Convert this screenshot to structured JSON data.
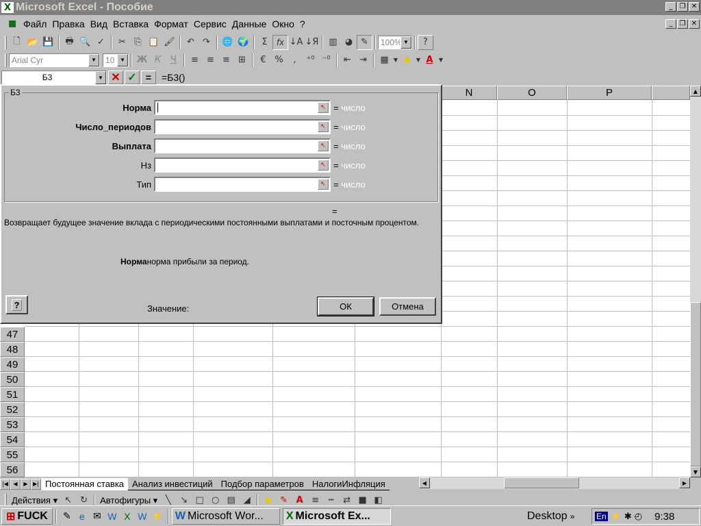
{
  "window": {
    "title": "Microsoft Excel - Пособие",
    "icon_glyph": "X"
  },
  "menu": {
    "items": [
      "Файл",
      "Правка",
      "Вид",
      "Вставка",
      "Формат",
      "Сервис",
      "Данные",
      "Окно",
      "?"
    ]
  },
  "toolbar_std": {
    "zoom": "100%"
  },
  "toolbar_fmt": {
    "font": "Arial Cyr",
    "size": "10",
    "bold": "Ж",
    "italic": "К",
    "underline": "Ч"
  },
  "formula": {
    "name_box": "Б3",
    "cancel": "✕",
    "enter": "✓",
    "equals": "=",
    "content": "=Б3()"
  },
  "sheet": {
    "columns": [
      "N",
      "O",
      "P"
    ],
    "rows": [
      "47",
      "48",
      "49",
      "50",
      "51",
      "52",
      "53",
      "54",
      "55",
      "56"
    ]
  },
  "dialog": {
    "group_title": "Б3",
    "args": [
      {
        "label": "Норма",
        "bold": true,
        "result": "= число",
        "result_eq": "=",
        "result_val": "число"
      },
      {
        "label": "Число_периодов",
        "bold": true,
        "result_eq": "=",
        "result_val": "число"
      },
      {
        "label": "Выплата",
        "bold": true,
        "result_eq": "=",
        "result_val": "число"
      },
      {
        "label": "Нз",
        "bold": false,
        "result_eq": "=",
        "result_val": "число"
      },
      {
        "label": "Тип",
        "bold": false,
        "result_eq": "=",
        "result_val": "число"
      }
    ],
    "total_result": "=",
    "description": "Возвращает будущее значение вклада  с периодическими постоянными выплатами и посточным процентом.",
    "arg_help_name": "Норма",
    "arg_help_text": "норма прибыли за период.",
    "value_label": "Значение:",
    "ok": "ОК",
    "cancel": "Отмена",
    "help_glyph": "?"
  },
  "sheet_tabs": [
    "Постоянная ставка",
    "Анализ инвестиций",
    "Подбор параметров",
    "НалогиИнфляция"
  ],
  "drawing": {
    "actions": "Действия ▾",
    "autoshapes": "Автофигуры ▾"
  },
  "taskbar": {
    "start": "FUCK",
    "tasks": [
      {
        "label": "Microsoft Wor...",
        "active": false
      },
      {
        "label": "Microsoft Ex...",
        "active": true
      }
    ],
    "desktop": "Desktop",
    "lang": "En",
    "clock": "9:38"
  }
}
